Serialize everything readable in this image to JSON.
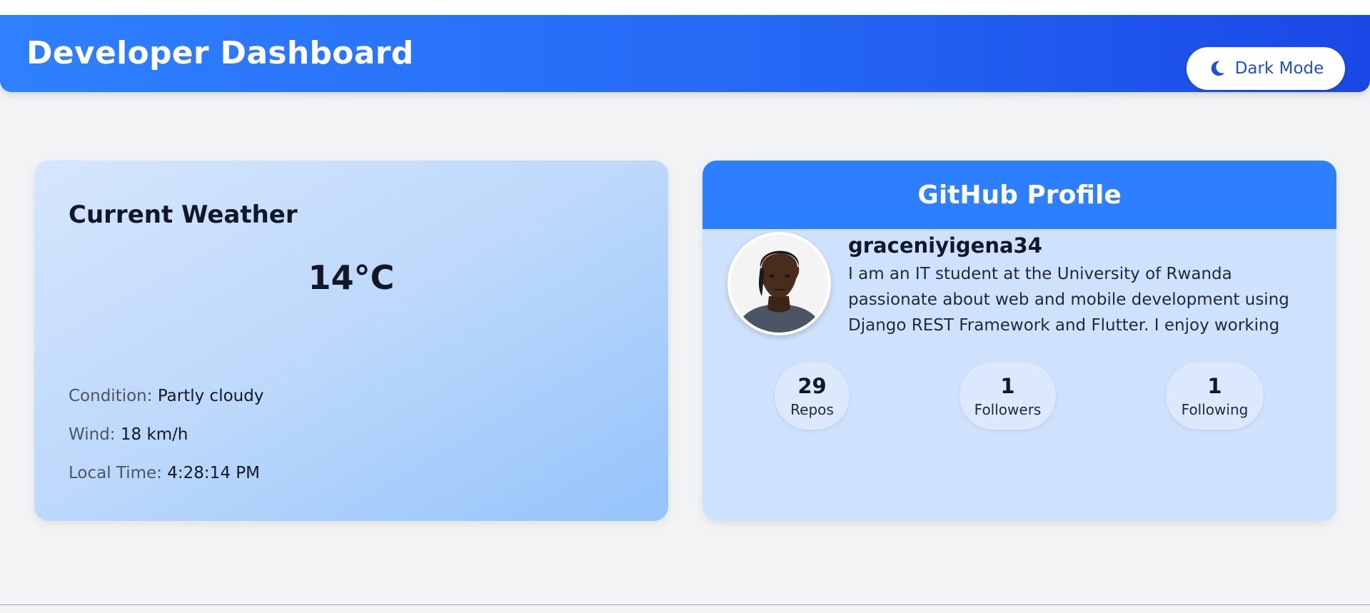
{
  "header": {
    "title": "Developer Dashboard",
    "dark_mode_label": "Dark Mode"
  },
  "weather": {
    "title": "Current Weather",
    "temperature": "14°C",
    "condition_label": "Condition:",
    "condition_value": "Partly cloudy",
    "wind_label": "Wind:",
    "wind_value": "18 km/h",
    "time_label": "Local Time:",
    "time_value": "4:28:14 PM"
  },
  "github": {
    "title": "GitHub Profile",
    "username": "graceniyigena34",
    "bio": "I am an IT student at the University of Rwanda passionate about web and mobile development using Django REST Framework and Flutter. I enjoy working",
    "stats": [
      {
        "value": "29",
        "label": "Repos"
      },
      {
        "value": "1",
        "label": "Followers"
      },
      {
        "value": "1",
        "label": "Following"
      }
    ]
  },
  "icons": {
    "dark_mode": "moon-icon",
    "avatar": "profile-photo"
  },
  "colors": {
    "header_gradient_start": "#2f80ff",
    "header_gradient_end": "#1a48e6",
    "github_header": "#2d7fff",
    "page_background": "#f2f3f5"
  }
}
